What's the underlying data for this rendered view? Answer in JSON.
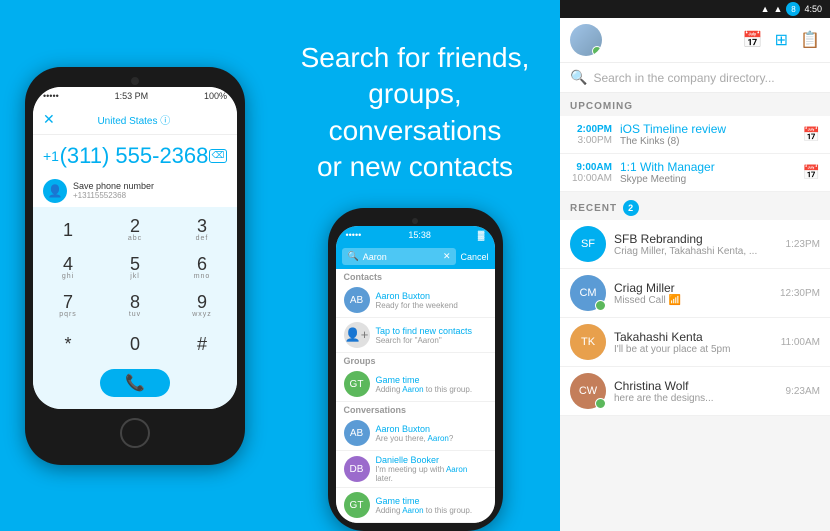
{
  "leftPhone": {
    "statusBar": {
      "dots": "•••••",
      "wifi": "wifi",
      "time": "1:53 PM",
      "battery": "100%"
    },
    "header": {
      "closeLabel": "✕",
      "countryLabel": "United States ⓘ",
      "countryCode": "+1"
    },
    "number": "(311) 555-2368",
    "saveText": "Save phone number",
    "saveSubText": "+13115552368",
    "deleteIcon": "⌫",
    "keys": [
      [
        {
          "num": "1",
          "sub": ""
        },
        {
          "num": "2",
          "sub": "abc"
        },
        {
          "num": "3",
          "sub": "def"
        }
      ],
      [
        {
          "num": "4",
          "sub": "ghi"
        },
        {
          "num": "5",
          "sub": "jkl"
        },
        {
          "num": "6",
          "sub": "mno"
        }
      ],
      [
        {
          "num": "7",
          "sub": "pqrs"
        },
        {
          "num": "8",
          "sub": "tuv"
        },
        {
          "num": "9",
          "sub": "wxyz"
        }
      ],
      [
        {
          "num": "*",
          "sub": ""
        },
        {
          "num": "0",
          "sub": ""
        },
        {
          "num": "#",
          "sub": ""
        }
      ]
    ],
    "callIcon": "📞"
  },
  "middleText": {
    "line1": "Search for friends,",
    "line2": "groups, conversations",
    "line3": "or new contacts"
  },
  "searchPhone": {
    "statusBar": {
      "dots": "•••••",
      "wifi": "wifi",
      "time": "15:38",
      "battery": ""
    },
    "searchQuery": "Aaron",
    "cancelLabel": "Cancel",
    "sections": [
      {
        "label": "Contacts",
        "items": [
          {
            "name": "Aaron Buxton",
            "sub": "Ready for the weekend",
            "avatarColor": "av-blue",
            "initials": "AB"
          },
          {
            "name": "Tap to find new contacts",
            "sub": "Search for \"Aaron\"",
            "avatarColor": "find",
            "initials": "👤"
          }
        ]
      },
      {
        "label": "Groups",
        "items": [
          {
            "name": "Game time",
            "sub": "Adding Aaron to this group.",
            "avatarColor": "av-green",
            "initials": "GT"
          }
        ]
      },
      {
        "label": "Conversations",
        "items": [
          {
            "name": "Aaron Buxton",
            "sub": "Are you there, Aaron?",
            "avatarColor": "av-blue",
            "initials": "AB"
          },
          {
            "name": "Danielle Booker",
            "sub": "I'm meeting up with Aaron later.",
            "avatarColor": "av-purple",
            "initials": "DB"
          },
          {
            "name": "Game time",
            "sub": "Adding Aaron to this group.",
            "avatarColor": "av-green",
            "initials": "GT"
          }
        ]
      }
    ]
  },
  "rightPanel": {
    "statusBar": {
      "time": "4:50",
      "batteryBadge": "8"
    },
    "header": {
      "icons": [
        "calendar-icon",
        "grid-icon",
        "contact-icon"
      ]
    },
    "searchPlaceholder": "Search in the company directory...",
    "upcoming": {
      "label": "UPCOMING",
      "items": [
        {
          "startTime": "2:00PM",
          "endTime": "3:00PM",
          "title": "iOS Timeline review",
          "sub": "The Kinks (8)"
        },
        {
          "startTime": "9:00AM",
          "endTime": "10:00AM",
          "title": "1:1 With Manager",
          "sub": "Skype Meeting"
        }
      ]
    },
    "recent": {
      "label": "RECENT",
      "count": "2",
      "items": [
        {
          "name": "SFB Rebranding",
          "sub": "Criag Miller, Takahashi Kenta, ...",
          "time": "1:23PM",
          "avatarColor": "av-teal",
          "initials": "SF",
          "statusColor": ""
        },
        {
          "name": "Criag Miller",
          "sub": "Missed Call 📶",
          "time": "12:30PM",
          "avatarColor": "av-blue",
          "initials": "CM",
          "statusColor": "status-green"
        },
        {
          "name": "Takahashi Kenta",
          "sub": "I'll be at your place at 5pm",
          "time": "11:00AM",
          "avatarColor": "av-orange",
          "initials": "TK",
          "statusColor": ""
        },
        {
          "name": "Christina Wolf",
          "sub": "here are the designs...",
          "time": "9:23AM",
          "avatarColor": "av-brown",
          "initials": "CW",
          "statusColor": "status-green"
        }
      ]
    }
  }
}
